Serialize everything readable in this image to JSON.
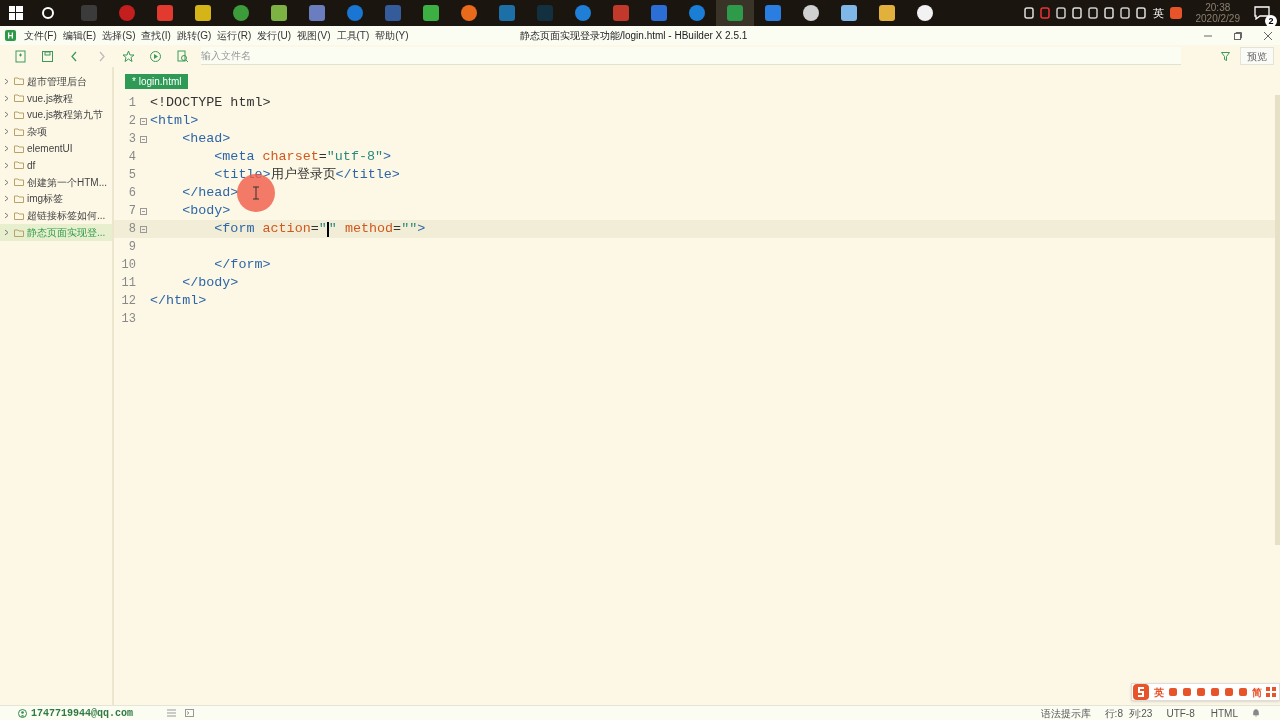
{
  "taskbar": {
    "tray_language": "英",
    "clock_time": "20:38",
    "clock_date": "2020/2/29",
    "notification_count": "2"
  },
  "window": {
    "title": "静态页面实现登录功能/login.html - HBuilder X 2.5.1"
  },
  "menu": [
    "文件(F)",
    "编辑(E)",
    "选择(S)",
    "查找(I)",
    "跳转(G)",
    "运行(R)",
    "发行(U)",
    "视图(V)",
    "工具(T)",
    "帮助(Y)"
  ],
  "toolbar": {
    "search_placeholder": "输入文件名",
    "preview_button": "预览"
  },
  "sidebar": {
    "items": [
      {
        "label": "超市管理后台",
        "selected": false
      },
      {
        "label": "vue.js教程",
        "selected": false
      },
      {
        "label": "vue.js教程第九节",
        "selected": false
      },
      {
        "label": "杂项",
        "selected": false
      },
      {
        "label": "elementUI",
        "selected": false
      },
      {
        "label": "df",
        "selected": false
      },
      {
        "label": "创建第一个HTM...",
        "selected": false
      },
      {
        "label": "img标签",
        "selected": false
      },
      {
        "label": "超链接标签如何...",
        "selected": false
      },
      {
        "label": "静态页面实现登...",
        "selected": true
      }
    ]
  },
  "tabs": [
    {
      "label": "* login.html",
      "selected": true
    }
  ],
  "editor": {
    "lines": [
      {
        "number": "1",
        "fold": false,
        "current": false,
        "tokens": [
          {
            "kind": "text",
            "text": "<!DOCTYPE html>"
          }
        ]
      },
      {
        "number": "2",
        "fold": true,
        "current": false,
        "tokens": [
          {
            "kind": "tag",
            "text": "<html>"
          }
        ]
      },
      {
        "number": "3",
        "fold": true,
        "current": false,
        "tokens": [
          {
            "kind": "tag",
            "text": "    <head>"
          }
        ]
      },
      {
        "number": "4",
        "fold": false,
        "current": false,
        "tokens": [
          {
            "kind": "tag",
            "text": "        <meta "
          },
          {
            "kind": "attr",
            "text": "charset"
          },
          {
            "kind": "text",
            "text": "="
          },
          {
            "kind": "string",
            "text": "\"utf-8\""
          },
          {
            "kind": "tag",
            "text": ">"
          }
        ]
      },
      {
        "number": "5",
        "fold": false,
        "current": false,
        "tokens": [
          {
            "kind": "tag",
            "text": "        <title>"
          },
          {
            "kind": "text",
            "text": "用户登录页"
          },
          {
            "kind": "tag",
            "text": "</title>"
          }
        ]
      },
      {
        "number": "6",
        "fold": false,
        "current": false,
        "tokens": [
          {
            "kind": "tag",
            "text": "    </head>"
          }
        ]
      },
      {
        "number": "7",
        "fold": true,
        "current": false,
        "tokens": [
          {
            "kind": "tag",
            "text": "    <body>"
          }
        ]
      },
      {
        "number": "8",
        "fold": true,
        "current": true,
        "tokens": [
          {
            "kind": "tag",
            "text": "        <form "
          },
          {
            "kind": "attr",
            "text": "action"
          },
          {
            "kind": "text",
            "text": "="
          },
          {
            "kind": "string",
            "text": "\""
          },
          {
            "kind": "caret"
          },
          {
            "kind": "string",
            "text": "\""
          },
          {
            "kind": "attr",
            "text": " method"
          },
          {
            "kind": "text",
            "text": "="
          },
          {
            "kind": "string",
            "text": "\"\""
          },
          {
            "kind": "tag",
            "text": ">"
          }
        ]
      },
      {
        "number": "9",
        "fold": false,
        "current": false
      },
      {
        "number": "10",
        "fold": false,
        "current": false,
        "tokens": [
          {
            "kind": "tag",
            "text": "        </form>"
          }
        ]
      },
      {
        "number": "11",
        "fold": false,
        "current": false,
        "tokens": [
          {
            "kind": "tag",
            "text": "    </body>"
          }
        ]
      },
      {
        "number": "12",
        "fold": false,
        "current": false,
        "tokens": [
          {
            "kind": "tag",
            "text": "</html>"
          }
        ]
      },
      {
        "number": "13",
        "fold": false,
        "current": false
      }
    ]
  },
  "ime_bar": {
    "mode": "英",
    "script": "简"
  },
  "status_bar": {
    "account": "1747719944@qq.com",
    "hint_library": "语法提示库",
    "position": "行:8  列:23",
    "encoding": "UTF-8",
    "language": "HTML"
  }
}
